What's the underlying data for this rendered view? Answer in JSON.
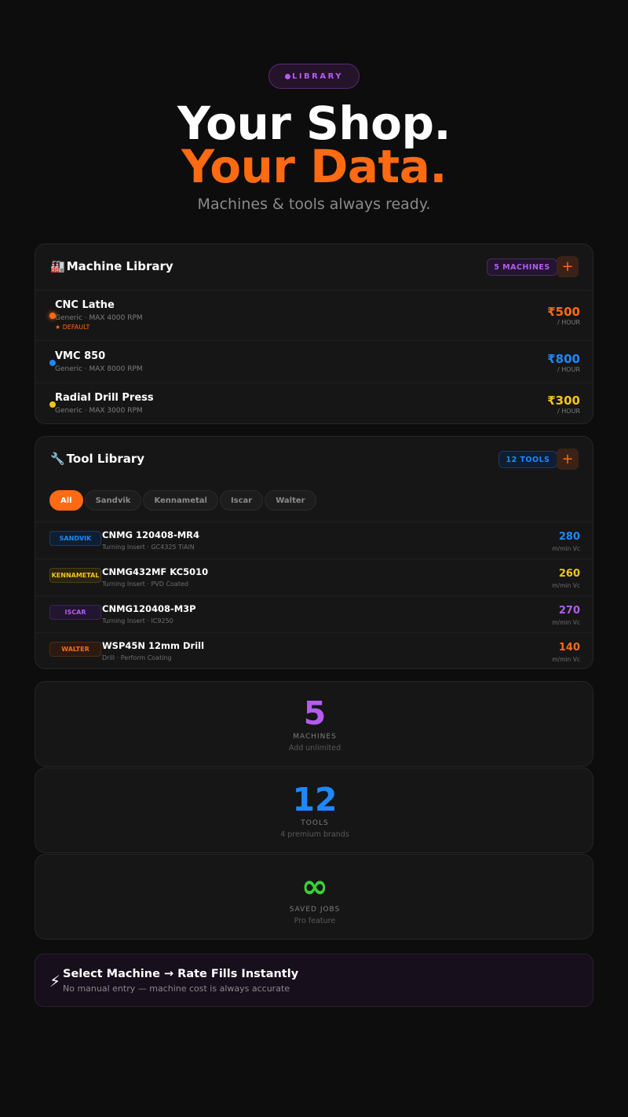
{
  "hero": {
    "pill": "LIBRARY",
    "title_line1": "Your Shop.",
    "title_line2": "Your Data.",
    "subtitle": "Machines & tools always ready."
  },
  "machine_library": {
    "icon": "factory-icon",
    "title": "Machine Library",
    "badge": "5 MACHINES",
    "add_label": "+",
    "machines": [
      {
        "name": "CNC Lathe",
        "spec": "Generic · MAX 4000 RPM",
        "default_label": "★ DEFAULT",
        "rate": "₹500",
        "unit": "/ HOUR",
        "color": "#ff6a13"
      },
      {
        "name": "VMC 850",
        "spec": "Generic · MAX 8000 RPM",
        "rate": "₹800",
        "unit": "/ HOUR",
        "color": "#1e88ff"
      },
      {
        "name": "Radial Drill Press",
        "spec": "Generic · MAX 3000 RPM",
        "rate": "₹300",
        "unit": "/ HOUR",
        "color": "#f5c518"
      }
    ]
  },
  "tool_library": {
    "icon": "wrench-icon",
    "title": "Tool Library",
    "badge": "12 TOOLS",
    "add_label": "+",
    "filters": [
      "All",
      "Sandvik",
      "Kennametal",
      "Iscar",
      "Walter"
    ],
    "active_filter": "All",
    "tools": [
      {
        "brand": "SANDVIK",
        "name": "CNMG 120408-MR4",
        "spec": "Turning Insert · GC4325 TiAlN",
        "speed": "280",
        "unit": "m/min Vc",
        "color": "#1e88ff",
        "brand_bg": "#0f1e33",
        "brand_border": "#1d3a5c"
      },
      {
        "brand": "KENNAMETAL",
        "name": "CNMG432MF KC5010",
        "spec": "Turning Insert · PVD Coated",
        "speed": "260",
        "unit": "m/min Vc",
        "color": "#f5c518",
        "brand_bg": "#2a2410",
        "brand_border": "#4a3f15"
      },
      {
        "brand": "ISCAR",
        "name": "CNMG120408-M3P",
        "spec": "Turning Insert · IC9250",
        "speed": "270",
        "unit": "m/min Vc",
        "color": "#b45cf0",
        "brand_bg": "#221530",
        "brand_border": "#3a2652"
      },
      {
        "brand": "WALTER",
        "name": "WSP45N 12mm Drill",
        "spec": "Drill · Perform Coating",
        "speed": "140",
        "unit": "m/min Vc",
        "color": "#ff6a13",
        "brand_bg": "#2c1a10",
        "brand_border": "#4e2b15"
      }
    ]
  },
  "stats": [
    {
      "value": "5",
      "label": "MACHINES",
      "note": "Add unlimited",
      "color": "#b45cf0"
    },
    {
      "value": "12",
      "label": "TOOLS",
      "note": "4 premium brands",
      "color": "#1e88ff"
    },
    {
      "value": "∞",
      "label": "SAVED JOBS",
      "note": "Pro feature",
      "color": "#3ad13a"
    }
  ],
  "banner": {
    "icon": "lightning-icon",
    "title": "Select Machine → Rate Fills Instantly",
    "subtitle": "No manual entry — machine cost is always accurate"
  }
}
